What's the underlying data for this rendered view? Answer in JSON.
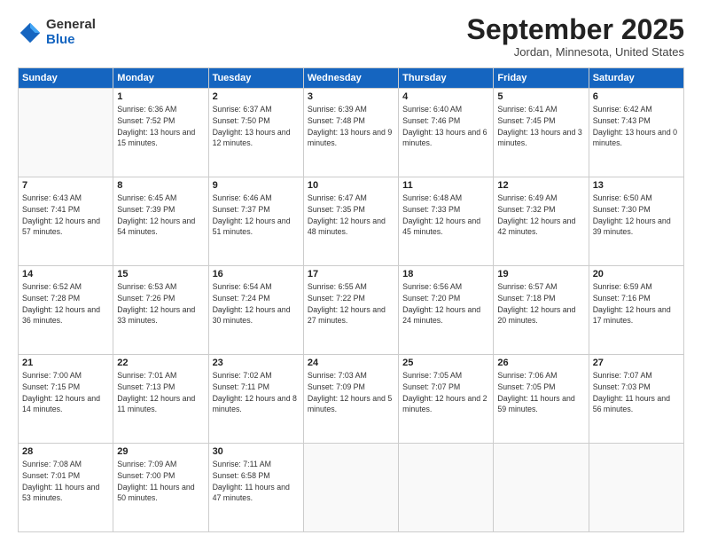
{
  "logo": {
    "general": "General",
    "blue": "Blue"
  },
  "header": {
    "month": "September 2025",
    "location": "Jordan, Minnesota, United States"
  },
  "days_of_week": [
    "Sunday",
    "Monday",
    "Tuesday",
    "Wednesday",
    "Thursday",
    "Friday",
    "Saturday"
  ],
  "weeks": [
    [
      {
        "day": "",
        "info": ""
      },
      {
        "day": "1",
        "info": "Sunrise: 6:36 AM\nSunset: 7:52 PM\nDaylight: 13 hours\nand 15 minutes."
      },
      {
        "day": "2",
        "info": "Sunrise: 6:37 AM\nSunset: 7:50 PM\nDaylight: 13 hours\nand 12 minutes."
      },
      {
        "day": "3",
        "info": "Sunrise: 6:39 AM\nSunset: 7:48 PM\nDaylight: 13 hours\nand 9 minutes."
      },
      {
        "day": "4",
        "info": "Sunrise: 6:40 AM\nSunset: 7:46 PM\nDaylight: 13 hours\nand 6 minutes."
      },
      {
        "day": "5",
        "info": "Sunrise: 6:41 AM\nSunset: 7:45 PM\nDaylight: 13 hours\nand 3 minutes."
      },
      {
        "day": "6",
        "info": "Sunrise: 6:42 AM\nSunset: 7:43 PM\nDaylight: 13 hours\nand 0 minutes."
      }
    ],
    [
      {
        "day": "7",
        "info": "Sunrise: 6:43 AM\nSunset: 7:41 PM\nDaylight: 12 hours\nand 57 minutes."
      },
      {
        "day": "8",
        "info": "Sunrise: 6:45 AM\nSunset: 7:39 PM\nDaylight: 12 hours\nand 54 minutes."
      },
      {
        "day": "9",
        "info": "Sunrise: 6:46 AM\nSunset: 7:37 PM\nDaylight: 12 hours\nand 51 minutes."
      },
      {
        "day": "10",
        "info": "Sunrise: 6:47 AM\nSunset: 7:35 PM\nDaylight: 12 hours\nand 48 minutes."
      },
      {
        "day": "11",
        "info": "Sunrise: 6:48 AM\nSunset: 7:33 PM\nDaylight: 12 hours\nand 45 minutes."
      },
      {
        "day": "12",
        "info": "Sunrise: 6:49 AM\nSunset: 7:32 PM\nDaylight: 12 hours\nand 42 minutes."
      },
      {
        "day": "13",
        "info": "Sunrise: 6:50 AM\nSunset: 7:30 PM\nDaylight: 12 hours\nand 39 minutes."
      }
    ],
    [
      {
        "day": "14",
        "info": "Sunrise: 6:52 AM\nSunset: 7:28 PM\nDaylight: 12 hours\nand 36 minutes."
      },
      {
        "day": "15",
        "info": "Sunrise: 6:53 AM\nSunset: 7:26 PM\nDaylight: 12 hours\nand 33 minutes."
      },
      {
        "day": "16",
        "info": "Sunrise: 6:54 AM\nSunset: 7:24 PM\nDaylight: 12 hours\nand 30 minutes."
      },
      {
        "day": "17",
        "info": "Sunrise: 6:55 AM\nSunset: 7:22 PM\nDaylight: 12 hours\nand 27 minutes."
      },
      {
        "day": "18",
        "info": "Sunrise: 6:56 AM\nSunset: 7:20 PM\nDaylight: 12 hours\nand 24 minutes."
      },
      {
        "day": "19",
        "info": "Sunrise: 6:57 AM\nSunset: 7:18 PM\nDaylight: 12 hours\nand 20 minutes."
      },
      {
        "day": "20",
        "info": "Sunrise: 6:59 AM\nSunset: 7:16 PM\nDaylight: 12 hours\nand 17 minutes."
      }
    ],
    [
      {
        "day": "21",
        "info": "Sunrise: 7:00 AM\nSunset: 7:15 PM\nDaylight: 12 hours\nand 14 minutes."
      },
      {
        "day": "22",
        "info": "Sunrise: 7:01 AM\nSunset: 7:13 PM\nDaylight: 12 hours\nand 11 minutes."
      },
      {
        "day": "23",
        "info": "Sunrise: 7:02 AM\nSunset: 7:11 PM\nDaylight: 12 hours\nand 8 minutes."
      },
      {
        "day": "24",
        "info": "Sunrise: 7:03 AM\nSunset: 7:09 PM\nDaylight: 12 hours\nand 5 minutes."
      },
      {
        "day": "25",
        "info": "Sunrise: 7:05 AM\nSunset: 7:07 PM\nDaylight: 12 hours\nand 2 minutes."
      },
      {
        "day": "26",
        "info": "Sunrise: 7:06 AM\nSunset: 7:05 PM\nDaylight: 11 hours\nand 59 minutes."
      },
      {
        "day": "27",
        "info": "Sunrise: 7:07 AM\nSunset: 7:03 PM\nDaylight: 11 hours\nand 56 minutes."
      }
    ],
    [
      {
        "day": "28",
        "info": "Sunrise: 7:08 AM\nSunset: 7:01 PM\nDaylight: 11 hours\nand 53 minutes."
      },
      {
        "day": "29",
        "info": "Sunrise: 7:09 AM\nSunset: 7:00 PM\nDaylight: 11 hours\nand 50 minutes."
      },
      {
        "day": "30",
        "info": "Sunrise: 7:11 AM\nSunset: 6:58 PM\nDaylight: 11 hours\nand 47 minutes."
      },
      {
        "day": "",
        "info": ""
      },
      {
        "day": "",
        "info": ""
      },
      {
        "day": "",
        "info": ""
      },
      {
        "day": "",
        "info": ""
      }
    ]
  ]
}
